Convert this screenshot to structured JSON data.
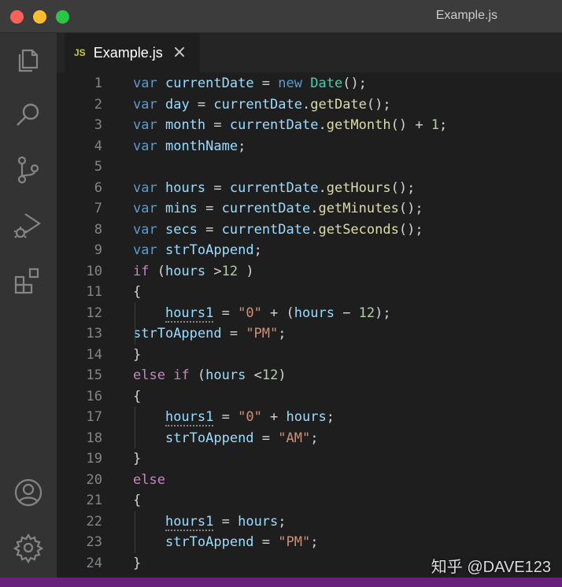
{
  "window": {
    "title": "Example.js"
  },
  "tab": {
    "badge": "JS",
    "label": "Example.js",
    "close": "×"
  },
  "activity_icons": [
    "explorer-icon",
    "search-icon",
    "source-control-icon",
    "run-debug-icon",
    "extensions-icon",
    "account-icon",
    "settings-gear-icon"
  ],
  "code_lines": [
    {
      "n": "1",
      "tokens": [
        [
          "kw",
          "var"
        ],
        [
          "op",
          " "
        ],
        [
          "var",
          "currentDate"
        ],
        [
          "op",
          " = "
        ],
        [
          "kw",
          "new"
        ],
        [
          "op",
          " "
        ],
        [
          "cls",
          "Date"
        ],
        [
          "op",
          "();"
        ]
      ]
    },
    {
      "n": "2",
      "tokens": [
        [
          "kw",
          "var"
        ],
        [
          "op",
          " "
        ],
        [
          "var",
          "day"
        ],
        [
          "op",
          " = "
        ],
        [
          "var",
          "currentDate"
        ],
        [
          "op",
          "."
        ],
        [
          "fn",
          "getDate"
        ],
        [
          "op",
          "();"
        ]
      ]
    },
    {
      "n": "3",
      "tokens": [
        [
          "kw",
          "var"
        ],
        [
          "op",
          " "
        ],
        [
          "var",
          "month"
        ],
        [
          "op",
          " = "
        ],
        [
          "var",
          "currentDate"
        ],
        [
          "op",
          "."
        ],
        [
          "fn",
          "getMonth"
        ],
        [
          "op",
          "() + "
        ],
        [
          "num",
          "1"
        ],
        [
          "op",
          ";"
        ]
      ]
    },
    {
      "n": "4",
      "tokens": [
        [
          "kw",
          "var"
        ],
        [
          "op",
          " "
        ],
        [
          "var",
          "monthName"
        ],
        [
          "op",
          ";"
        ]
      ]
    },
    {
      "n": "5",
      "tokens": []
    },
    {
      "n": "6",
      "tokens": [
        [
          "kw",
          "var"
        ],
        [
          "op",
          " "
        ],
        [
          "var",
          "hours"
        ],
        [
          "op",
          " = "
        ],
        [
          "var",
          "currentDate"
        ],
        [
          "op",
          "."
        ],
        [
          "fn",
          "getHours"
        ],
        [
          "op",
          "();"
        ]
      ]
    },
    {
      "n": "7",
      "tokens": [
        [
          "kw",
          "var"
        ],
        [
          "op",
          " "
        ],
        [
          "var",
          "mins"
        ],
        [
          "op",
          " = "
        ],
        [
          "var",
          "currentDate"
        ],
        [
          "op",
          "."
        ],
        [
          "fn",
          "getMinutes"
        ],
        [
          "op",
          "();"
        ]
      ]
    },
    {
      "n": "8",
      "tokens": [
        [
          "kw",
          "var"
        ],
        [
          "op",
          " "
        ],
        [
          "var",
          "secs"
        ],
        [
          "op",
          " = "
        ],
        [
          "var",
          "currentDate"
        ],
        [
          "op",
          "."
        ],
        [
          "fn",
          "getSeconds"
        ],
        [
          "op",
          "();"
        ]
      ]
    },
    {
      "n": "9",
      "tokens": [
        [
          "kw",
          "var"
        ],
        [
          "op",
          " "
        ],
        [
          "var",
          "strToAppend"
        ],
        [
          "op",
          ";"
        ]
      ]
    },
    {
      "n": "10",
      "tokens": [
        [
          "ctl",
          "if"
        ],
        [
          "op",
          " ("
        ],
        [
          "var",
          "hours"
        ],
        [
          "op",
          " >"
        ],
        [
          "num",
          "12"
        ],
        [
          "op",
          " )"
        ]
      ]
    },
    {
      "n": "11",
      "tokens": [
        [
          "op",
          "{"
        ]
      ]
    },
    {
      "n": "12",
      "tokens": [
        [
          "op",
          "    "
        ],
        [
          "var undecl",
          "hours1"
        ],
        [
          "op",
          " = "
        ],
        [
          "str",
          "\"0\""
        ],
        [
          "op",
          " + ("
        ],
        [
          "var",
          "hours"
        ],
        [
          "op",
          " − "
        ],
        [
          "num",
          "12"
        ],
        [
          "op",
          ");"
        ]
      ]
    },
    {
      "n": "13",
      "tokens": [
        [
          "var",
          "strToAppend"
        ],
        [
          "op",
          " = "
        ],
        [
          "str",
          "\"PM\""
        ],
        [
          "op",
          ";"
        ]
      ]
    },
    {
      "n": "14",
      "tokens": [
        [
          "op",
          "}"
        ]
      ]
    },
    {
      "n": "15",
      "tokens": [
        [
          "ctl",
          "else"
        ],
        [
          "op",
          " "
        ],
        [
          "ctl",
          "if"
        ],
        [
          "op",
          " ("
        ],
        [
          "var",
          "hours"
        ],
        [
          "op",
          " <"
        ],
        [
          "num",
          "12"
        ],
        [
          "op",
          ")"
        ]
      ]
    },
    {
      "n": "16",
      "tokens": [
        [
          "op",
          "{"
        ]
      ]
    },
    {
      "n": "17",
      "tokens": [
        [
          "op",
          "    "
        ],
        [
          "var undecl",
          "hours1"
        ],
        [
          "op",
          " = "
        ],
        [
          "str",
          "\"0\""
        ],
        [
          "op",
          " + "
        ],
        [
          "var",
          "hours"
        ],
        [
          "op",
          ";"
        ]
      ]
    },
    {
      "n": "18",
      "tokens": [
        [
          "op",
          "    "
        ],
        [
          "var",
          "strToAppend"
        ],
        [
          "op",
          " = "
        ],
        [
          "str",
          "\"AM\""
        ],
        [
          "op",
          ";"
        ]
      ]
    },
    {
      "n": "19",
      "tokens": [
        [
          "op",
          "}"
        ]
      ]
    },
    {
      "n": "20",
      "tokens": [
        [
          "ctl",
          "else"
        ]
      ]
    },
    {
      "n": "21",
      "tokens": [
        [
          "op",
          "{"
        ]
      ]
    },
    {
      "n": "22",
      "tokens": [
        [
          "op",
          "    "
        ],
        [
          "var undecl",
          "hours1"
        ],
        [
          "op",
          " = "
        ],
        [
          "var",
          "hours"
        ],
        [
          "op",
          ";"
        ]
      ]
    },
    {
      "n": "23",
      "tokens": [
        [
          "op",
          "    "
        ],
        [
          "var",
          "strToAppend"
        ],
        [
          "op",
          " = "
        ],
        [
          "str",
          "\"PM\""
        ],
        [
          "op",
          ";"
        ]
      ]
    },
    {
      "n": "24",
      "tokens": [
        [
          "op",
          "}"
        ]
      ]
    }
  ],
  "watermark": "知乎 @DAVE123",
  "colors": {
    "statusbar": "#68217a",
    "keyword": "#569cd6",
    "control": "#c586c0",
    "variable": "#9cdcfe",
    "function": "#dcdcaa",
    "class": "#4ec9b0",
    "number": "#b5cea8",
    "string": "#ce9178"
  }
}
